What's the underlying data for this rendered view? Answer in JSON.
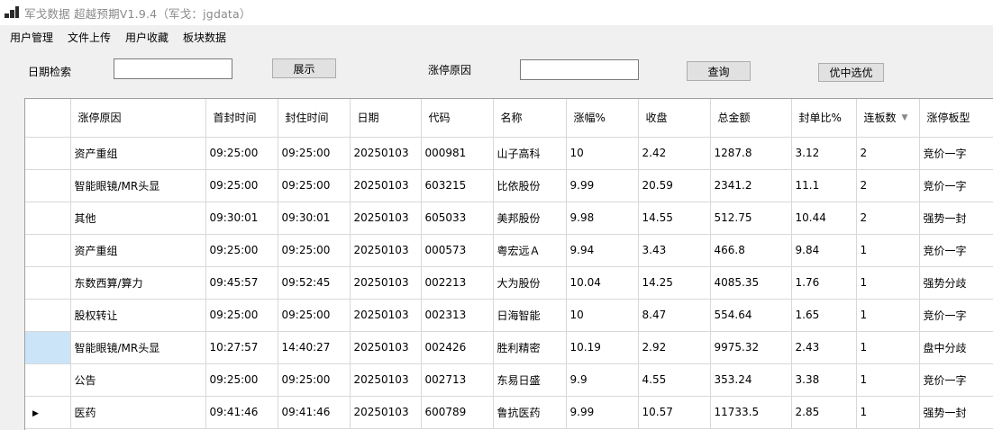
{
  "window": {
    "title": "军戈数据 超越预期V1.9.4（军戈：jgdata）"
  },
  "menu": [
    "用户管理",
    "文件上传",
    "用户收藏",
    "板块数据"
  ],
  "toolbar": {
    "date_label": "日期检索",
    "date_value": "",
    "show_button": "展示",
    "reason_label": "涨停原因",
    "reason_value": "",
    "query_button": "查询",
    "pick_button": "优中选优"
  },
  "grid": {
    "columns": [
      "涨停原因",
      "首封时间",
      "封住时间",
      "日期",
      "代码",
      "名称",
      "涨幅%",
      "收盘",
      "总金额",
      "封单比%",
      "连板数",
      "涨停板型"
    ],
    "rows": [
      [
        "资产重组",
        "09:25:00",
        "09:25:00",
        "20250103",
        "000981",
        "山子高科",
        "10",
        "2.42",
        "1287.8",
        "3.12",
        "2",
        "竞价一字"
      ],
      [
        "智能眼镜/MR头显",
        "09:25:00",
        "09:25:00",
        "20250103",
        "603215",
        "比依股份",
        "9.99",
        "20.59",
        "2341.2",
        "11.1",
        "2",
        "竞价一字"
      ],
      [
        "其他",
        "09:30:01",
        "09:30:01",
        "20250103",
        "605033",
        "美邦股份",
        "9.98",
        "14.55",
        "512.75",
        "10.44",
        "2",
        "强势一封"
      ],
      [
        "资产重组",
        "09:25:00",
        "09:25:00",
        "20250103",
        "000573",
        "粤宏远Ａ",
        "9.94",
        "3.43",
        "466.8",
        "9.84",
        "1",
        "竞价一字"
      ],
      [
        "东数西算/算力",
        "09:45:57",
        "09:52:45",
        "20250103",
        "002213",
        "大为股份",
        "10.04",
        "14.25",
        "4085.35",
        "1.76",
        "1",
        "强势分歧"
      ],
      [
        "股权转让",
        "09:25:00",
        "09:25:00",
        "20250103",
        "002313",
        "日海智能",
        "10",
        "8.47",
        "554.64",
        "1.65",
        "1",
        "竞价一字"
      ],
      [
        "智能眼镜/MR头显",
        "10:27:57",
        "14:40:27",
        "20250103",
        "002426",
        "胜利精密",
        "10.19",
        "2.92",
        "9975.32",
        "2.43",
        "1",
        "盘中分歧"
      ],
      [
        "公告",
        "09:25:00",
        "09:25:00",
        "20250103",
        "002713",
        "东易日盛",
        "9.9",
        "4.55",
        "353.24",
        "3.38",
        "1",
        "竞价一字"
      ],
      [
        "医药",
        "09:41:46",
        "09:41:46",
        "20250103",
        "600789",
        "鲁抗医药",
        "9.99",
        "10.57",
        "11733.5",
        "2.85",
        "1",
        "强势一封"
      ]
    ],
    "selected_row": 6,
    "current_row": 8
  }
}
